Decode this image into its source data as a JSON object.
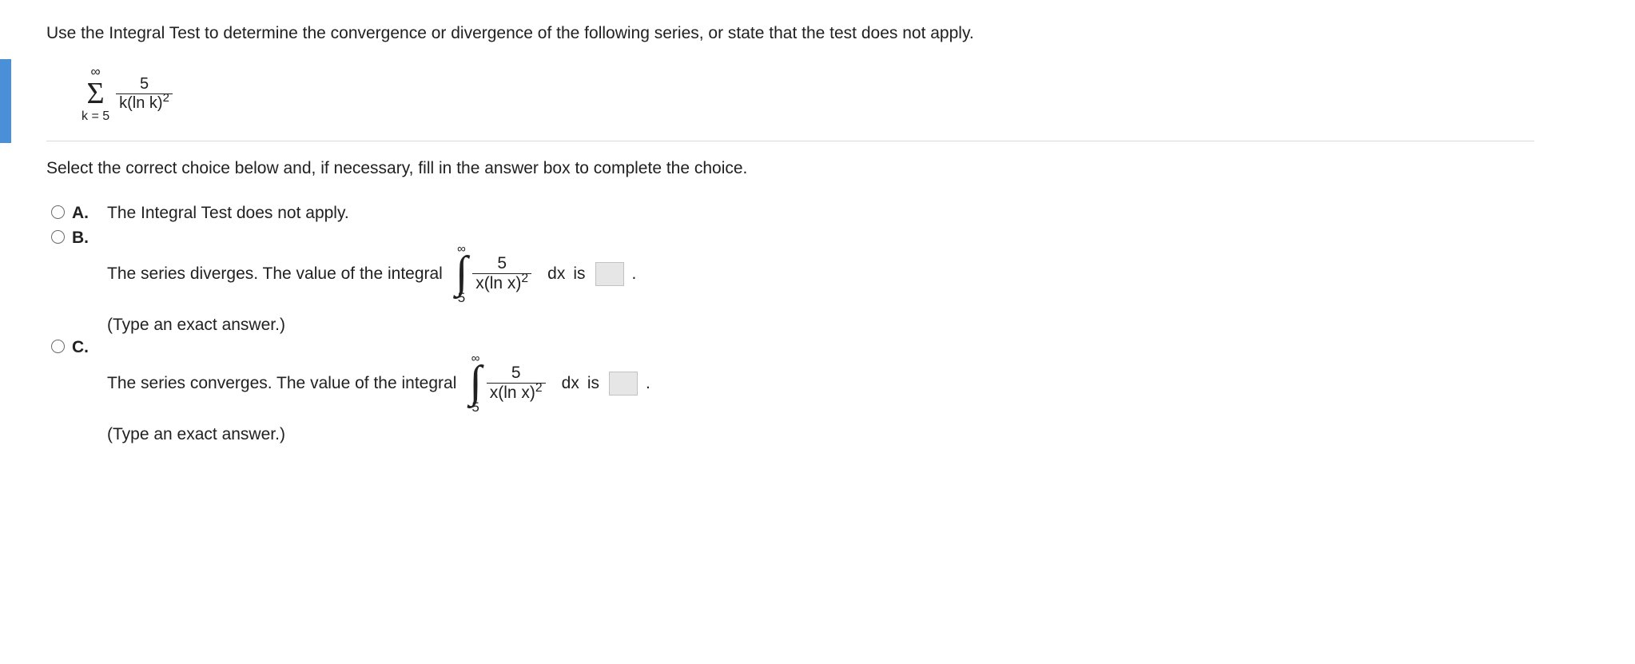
{
  "prompt": "Use the Integral Test to determine the convergence or divergence of the following series, or state that the test does not apply.",
  "series": {
    "top": "∞",
    "bottom": "k = 5",
    "frac_num": "5",
    "frac_den_left": "k(ln k)",
    "frac_den_exp": "2"
  },
  "instruct": "Select the correct choice below and, if necessary, fill in the answer box to complete the choice.",
  "choices": {
    "a": {
      "letter": "A.",
      "text": "The Integral Test does not apply."
    },
    "b": {
      "letter": "B.",
      "text_before": "The series diverges. The value of the integral",
      "integral": {
        "top": "∞",
        "bottom": "5",
        "frac_num": "5",
        "frac_den_left": "x(ln x)",
        "frac_den_exp": "2"
      },
      "dx": "dx",
      "is": "is",
      "period": ".",
      "hint": "(Type an exact answer.)"
    },
    "c": {
      "letter": "C.",
      "text_before": "The series converges. The value of the integral",
      "integral": {
        "top": "∞",
        "bottom": "5",
        "frac_num": "5",
        "frac_den_left": "x(ln x)",
        "frac_den_exp": "2"
      },
      "dx": "dx",
      "is": "is",
      "period": ".",
      "hint": "(Type an exact answer.)"
    }
  }
}
